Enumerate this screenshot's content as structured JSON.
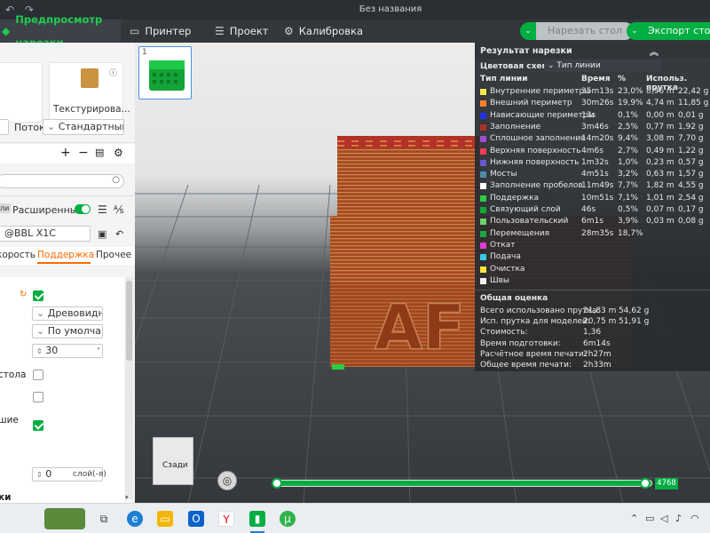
{
  "window": {
    "title": "Без названия"
  },
  "toolbar": {
    "tabs": [
      {
        "label": "Предпросмотр нарезки",
        "icon": "preview-cube-icon"
      },
      {
        "label": "Принтер",
        "icon": "printer-icon"
      },
      {
        "label": "Проект",
        "icon": "project-list-icon"
      },
      {
        "label": "Калибровка",
        "icon": "calibration-gear-icon"
      }
    ],
    "slice_button": "Нарезать стол",
    "export_button": "Экспорт столу"
  },
  "left_panel": {
    "filament_card_label": "Текстурирова...",
    "flow_label": "Поток",
    "flow_value": "Стандартный",
    "advanced_label": "Расширенный",
    "mode_tag": "ли",
    "printer_preset": "@BBL X1C",
    "tabs": [
      "корость",
      "Поддержка",
      "Прочее"
    ],
    "support_type": "Древовидн...",
    "support_style": "По умолча...",
    "threshold_angle": "30",
    "threshold_unit": "°",
    "row_label_plate": "стола",
    "row_label_shie": "шие",
    "interface_value": "0",
    "interface_unit": "слой(-я)",
    "bottom_label": "ки"
  },
  "result_panel": {
    "title": "Результат нарезки",
    "color_scheme_label": "Цветовая схема",
    "color_scheme_value": "Тип линии",
    "columns": [
      "Тип линии",
      "Время",
      "%",
      "Использ. прутка"
    ],
    "rows": [
      {
        "name": "Внутренние периметры",
        "time": "35m13s",
        "pct": "23,0%",
        "len": "8,96 m",
        "weight": "22,42 g",
        "color": "#f6e84a"
      },
      {
        "name": "Внешний периметр",
        "time": "30m26s",
        "pct": "19,9%",
        "len": "4,74 m",
        "weight": "11,85 g",
        "color": "#ff7f2a"
      },
      {
        "name": "Нависающие периметры",
        "time": "13s",
        "pct": "0,1%",
        "len": "0,00 m",
        "weight": "0,01 g",
        "color": "#2030e8"
      },
      {
        "name": "Заполнение",
        "time": "3m46s",
        "pct": "2,5%",
        "len": "0,77 m",
        "weight": "1,92 g",
        "color": "#b03028"
      },
      {
        "name": "Сплошное заполнение",
        "time": "14m20s",
        "pct": "9,4%",
        "len": "3,08 m",
        "weight": "7,70 g",
        "color": "#9c4fcf"
      },
      {
        "name": "Верхняя поверхность",
        "time": "4m6s",
        "pct": "2,7%",
        "len": "0,49 m",
        "weight": "1,22 g",
        "color": "#f23c5a"
      },
      {
        "name": "Нижняя поверхность",
        "time": "1m32s",
        "pct": "1,0%",
        "len": "0,23 m",
        "weight": "0,57 g",
        "color": "#6a5acd"
      },
      {
        "name": "Мосты",
        "time": "4m51s",
        "pct": "3,2%",
        "len": "0,63 m",
        "weight": "1,57 g",
        "color": "#4a8fa8"
      },
      {
        "name": "Заполнение пробелов",
        "time": "11m49s",
        "pct": "7,7%",
        "len": "1,82 m",
        "weight": "4,55 g",
        "color": "#ffffff"
      },
      {
        "name": "Поддержка",
        "time": "10m51s",
        "pct": "7,1%",
        "len": "1,01 m",
        "weight": "2,54 g",
        "color": "#2ecc40"
      },
      {
        "name": "Связующий слой",
        "time": "46s",
        "pct": "0,5%",
        "len": "0,07 m",
        "weight": "0,17 g",
        "color": "#14a632"
      },
      {
        "name": "Пользовательский",
        "time": "6m1s",
        "pct": "3,9%",
        "len": "0,03 m",
        "weight": "0,08 g",
        "color": "#6ed36e"
      },
      {
        "name": "Перемещения",
        "time": "28m35s",
        "pct": "18,7%",
        "len": "",
        "weight": "",
        "color": "#1aa83a"
      },
      {
        "name": "Откат",
        "time": "",
        "pct": "",
        "len": "",
        "weight": "",
        "color": "#e23bd6"
      },
      {
        "name": "Подача",
        "time": "",
        "pct": "",
        "len": "",
        "weight": "",
        "color": "#39c9e6"
      },
      {
        "name": "Очистка",
        "time": "",
        "pct": "",
        "len": "",
        "weight": "",
        "color": "#f7e63c"
      },
      {
        "name": "Швы",
        "time": "",
        "pct": "",
        "len": "",
        "weight": "",
        "color": "#f2f2f2"
      }
    ],
    "summary_title": "Общая оценка",
    "summary": [
      {
        "label": "Всего использовано прутка:",
        "v1": "21,83 m",
        "v2": "54,62 g"
      },
      {
        "label": "Исп. прутка для моделей:",
        "v1": "20,75 m",
        "v2": "51,91 g"
      },
      {
        "label": "Стоимость:",
        "v1": "1,36",
        "v2": ""
      },
      {
        "label": "Время подготовки:",
        "v1": "6m14s",
        "v2": ""
      },
      {
        "label": "Расчётное время печати:",
        "v1": "2h27m",
        "v2": ""
      },
      {
        "label": "Общее время печати:",
        "v1": "2h33m",
        "v2": ""
      }
    ]
  },
  "viewport": {
    "plate_number": "1",
    "nav_cube_label": "Сзади",
    "model_text": "AF",
    "layer_value": "4768",
    "layer_progress": 1.0
  },
  "colors": {
    "accent": "#00ae42",
    "model_brown": "#a5491e",
    "model_red": "#c23a2c"
  }
}
